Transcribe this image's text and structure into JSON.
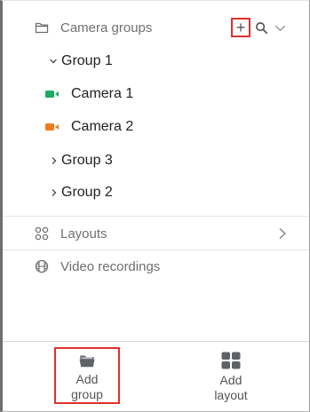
{
  "colors": {
    "highlight_border": "#e0302d",
    "camera_online": "#1dab63",
    "camera_offline": "#f07a1d",
    "muted_text": "#6f6f6f",
    "icon_gray": "#5f6368"
  },
  "camera_groups": {
    "label": "Camera groups",
    "icon": "folder-icon",
    "add_label": "+",
    "search_icon": "search-icon",
    "collapse_icon": "chevron-down-icon"
  },
  "tree": {
    "group1": {
      "label": "Group 1",
      "expanded": true
    },
    "camera1": {
      "label": "Camera 1",
      "status_color": "#1dab63"
    },
    "camera2": {
      "label": "Camera 2",
      "status_color": "#f07a1d"
    },
    "group3": {
      "label": "Group 3",
      "expanded": false
    },
    "group2": {
      "label": "Group 2",
      "expanded": false
    }
  },
  "nav": {
    "layouts": {
      "label": "Layouts",
      "icon": "layouts-icon"
    },
    "video_recordings": {
      "label": "Video recordings",
      "icon": "film-icon"
    }
  },
  "footer": {
    "add_group": {
      "line1": "Add",
      "line2": "group",
      "icon": "folder-open-icon"
    },
    "add_layout": {
      "line1": "Add",
      "line2": "layout",
      "icon": "grid-icon"
    }
  }
}
